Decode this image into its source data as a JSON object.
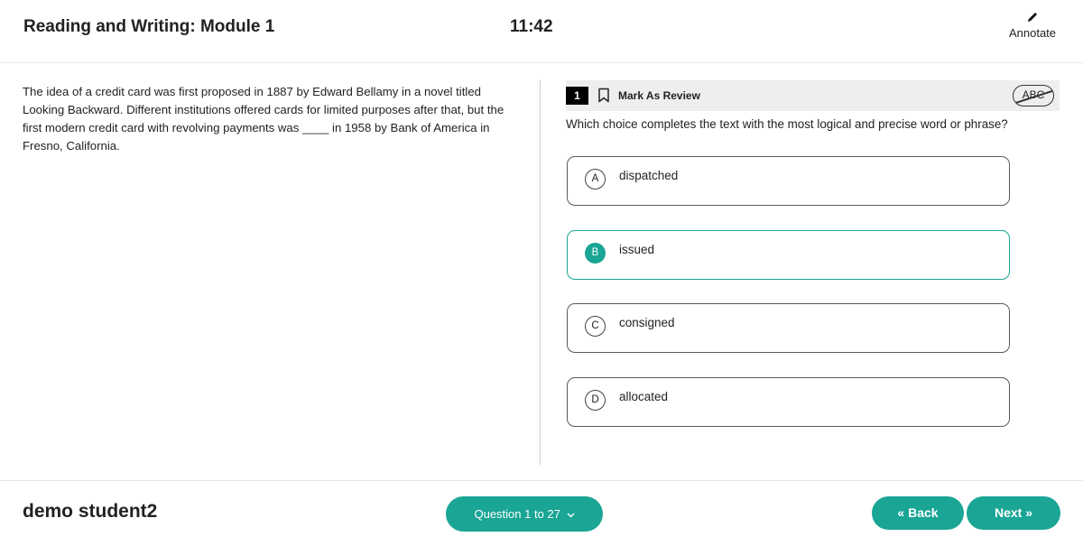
{
  "header": {
    "module_title": "Reading and Writing: Module 1",
    "timer": "11:42",
    "annotate_label": "Annotate",
    "annotate_icon": "pencil-icon"
  },
  "passage": {
    "text": "The idea of a credit card was first proposed in 1887 by Edward Bellamy in a novel titled Looking Backward. Different institutions offered cards for limited purposes after that, but the first modern credit card with revolving payments was ____ in 1958 by Bank of America in Fresno, California."
  },
  "question": {
    "number": "1",
    "mark_review_label": "Mark As Review",
    "abc_label": "ABC",
    "prompt": "Which choice completes the text with the most logical and precise word or phrase?",
    "choices": [
      {
        "letter": "A",
        "text": "dispatched"
      },
      {
        "letter": "B",
        "text": "issued"
      },
      {
        "letter": "C",
        "text": "consigned"
      },
      {
        "letter": "D",
        "text": "allocated"
      }
    ],
    "selected": "B"
  },
  "footer": {
    "student_name": "demo student2",
    "question_nav_label": "Question 1 to 27",
    "back_label": "« Back",
    "next_label": "Next »"
  },
  "colors": {
    "accent": "#1aa595",
    "text": "#222222",
    "question_bar_bg": "#eeeeee"
  }
}
